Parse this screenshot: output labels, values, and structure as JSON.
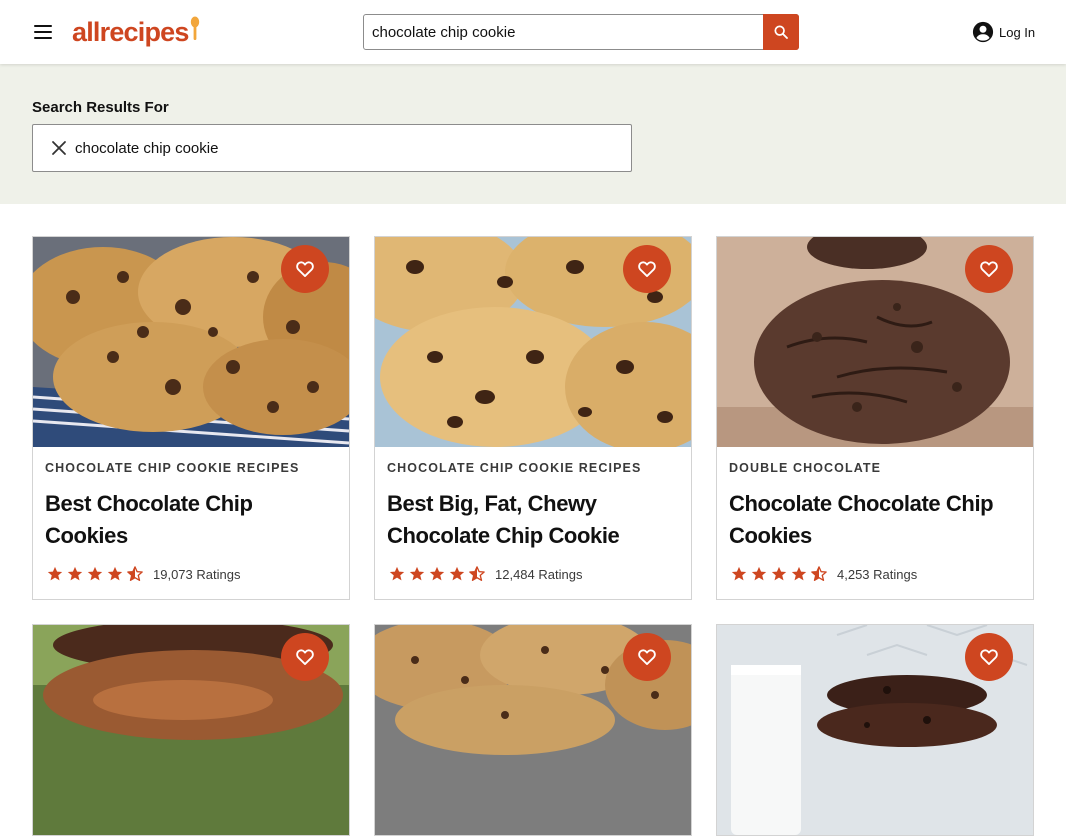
{
  "header": {
    "logo": "allrecipes",
    "search_value": "chocolate chip cookie",
    "login_label": "Log In"
  },
  "results": {
    "label": "Search Results For",
    "query": "chocolate chip cookie"
  },
  "colors": {
    "brand": "#ce4620",
    "panel_bg": "#eff1e9"
  },
  "icons": [
    "menu-icon",
    "spoon-icon",
    "search-icon",
    "account-icon",
    "close-icon",
    "heart-icon",
    "star-icon",
    "half-star-icon"
  ],
  "cards": [
    {
      "category": "Chocolate Chip Cookie Recipes",
      "title": "Best Chocolate Chip Cookies",
      "rating": 4.5,
      "ratings_text": "19,073 Ratings"
    },
    {
      "category": "Chocolate Chip Cookie Recipes",
      "title": "Best Big, Fat, Chewy Chocolate Chip Cookie",
      "rating": 4.5,
      "ratings_text": "12,484 Ratings"
    },
    {
      "category": "Double Chocolate",
      "title": "Chocolate Chocolate Chip Cookies",
      "rating": 4.5,
      "ratings_text": "4,253 Ratings"
    },
    {
      "category": "",
      "title": "",
      "rating": null,
      "ratings_text": ""
    },
    {
      "category": "",
      "title": "",
      "rating": null,
      "ratings_text": ""
    },
    {
      "category": "",
      "title": "",
      "rating": null,
      "ratings_text": ""
    }
  ]
}
